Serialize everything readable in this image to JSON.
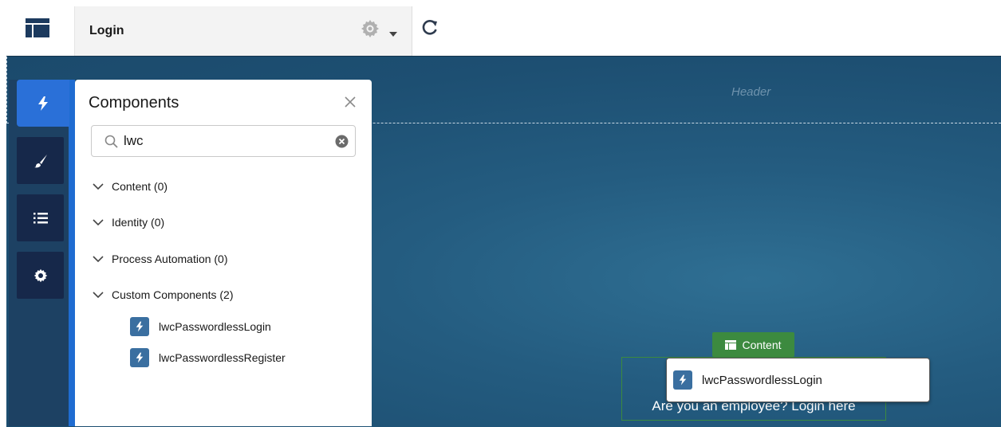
{
  "topbar": {
    "page_name": "Login",
    "icons": {
      "layout": "layout-icon",
      "settings": "gear-icon",
      "dropdown": "caret-down-icon",
      "refresh": "refresh-icon"
    }
  },
  "canvas": {
    "header_label": "Header",
    "content_label": "Content",
    "content_text": "Are you an employee? Login here",
    "dragged_component": "lwcPasswordlessLogin"
  },
  "dock": {
    "items": [
      {
        "icon": "lightning-bolt-icon",
        "active": true
      },
      {
        "icon": "paintbrush-icon",
        "active": false
      },
      {
        "icon": "list-icon",
        "active": false
      },
      {
        "icon": "gear-icon",
        "active": false
      }
    ]
  },
  "panel": {
    "title": "Components",
    "search": {
      "value": "lwc",
      "placeholder": ""
    },
    "sections": [
      {
        "label": "Content (0)"
      },
      {
        "label": "Identity (0)"
      },
      {
        "label": "Process Automation (0)"
      },
      {
        "label": "Custom Components (2)"
      }
    ],
    "custom_components": [
      {
        "label": "lwcPasswordlessLogin"
      },
      {
        "label": "lwcPasswordlessRegister"
      }
    ]
  },
  "colors": {
    "accent": "#2a70d8",
    "content_green": "#3c8a3f",
    "dock": "#1d4163",
    "lwc_tile": "#3a6fa0"
  }
}
